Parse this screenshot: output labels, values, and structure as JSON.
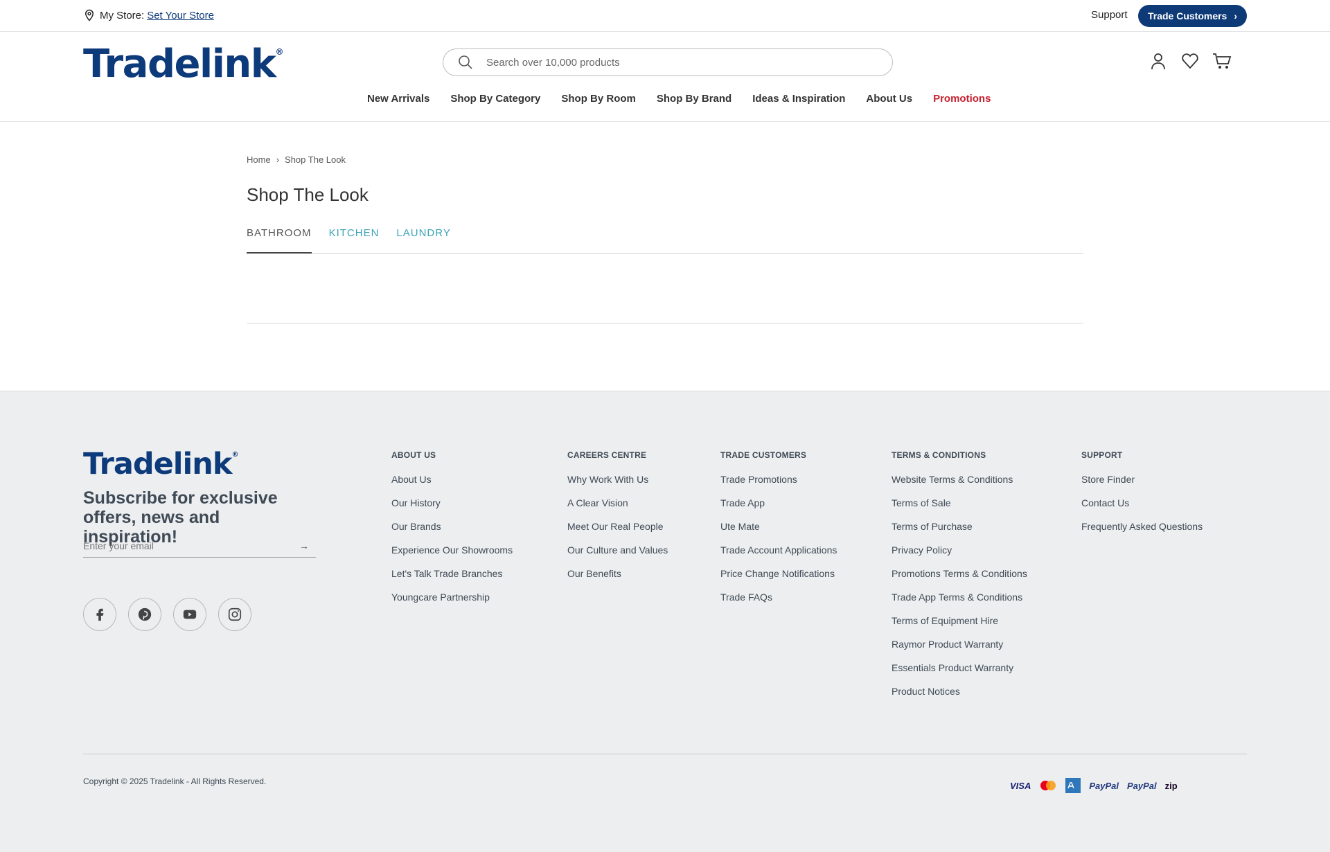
{
  "topbar": {
    "store_label": "My Store:",
    "store_link": "Set Your Store",
    "support": "Support",
    "trade_button": "Trade Customers"
  },
  "header": {
    "logo_text": "Tradelink",
    "search_placeholder": "Search over 10,000 products",
    "nav": [
      "New Arrivals",
      "Shop By Category",
      "Shop By Room",
      "Shop By Brand",
      "Ideas & Inspiration",
      "About Us",
      "Promotions"
    ]
  },
  "breadcrumb": [
    "Home",
    "Shop The Look"
  ],
  "page_title": "Shop The Look",
  "tabs": [
    {
      "label": "BATHROOM",
      "active": true
    },
    {
      "label": "KITCHEN",
      "active": false
    },
    {
      "label": "LAUNDRY",
      "active": false
    }
  ],
  "footer": {
    "logo_text": "Tradelink",
    "subscribe_heading": "Subscribe for exclusive offers, news and inspiration!",
    "email_placeholder": "Enter your email",
    "social_icons": [
      "facebook-icon",
      "pinterest-icon",
      "youtube-icon",
      "instagram-icon"
    ],
    "columns": [
      {
        "title": "ABOUT US",
        "links": [
          "About Us",
          "Our History",
          "Our Brands",
          "Experience Our Showrooms",
          "Let's Talk Trade Branches",
          "Youngcare Partnership"
        ]
      },
      {
        "title": "CAREERS CENTRE",
        "links": [
          "Why Work With Us",
          "A Clear Vision",
          "Meet Our Real People",
          "Our Culture and Values",
          "Our Benefits"
        ]
      },
      {
        "title": "TRADE CUSTOMERS",
        "links": [
          "Trade Promotions",
          "Trade App",
          "Ute Mate",
          "Trade Account Applications",
          "Price Change Notifications",
          "Trade FAQs"
        ]
      },
      {
        "title": "TERMS & CONDITIONS",
        "links": [
          "Website Terms & Conditions",
          "Terms of Sale",
          "Terms of Purchase",
          "Privacy Policy",
          "Promotions Terms & Conditions",
          "Trade App Terms & Conditions",
          "Terms of Equipment Hire",
          "Raymor Product Warranty",
          "Essentials Product Warranty",
          "Product Notices"
        ]
      },
      {
        "title": "SUPPORT",
        "links": [
          "Store Finder",
          "Contact Us",
          "Frequently Asked Questions"
        ]
      }
    ],
    "copyright": "Copyright © 2025 Tradelink - All Rights Reserved.",
    "payments": [
      "VISA",
      "PayPal",
      "PayPal",
      "zip"
    ]
  },
  "colors": {
    "brand": "#0d3a7a",
    "promo": "#c8202f",
    "tab_inactive": "#3aa3b6",
    "footer_bg": "#eceef0"
  }
}
